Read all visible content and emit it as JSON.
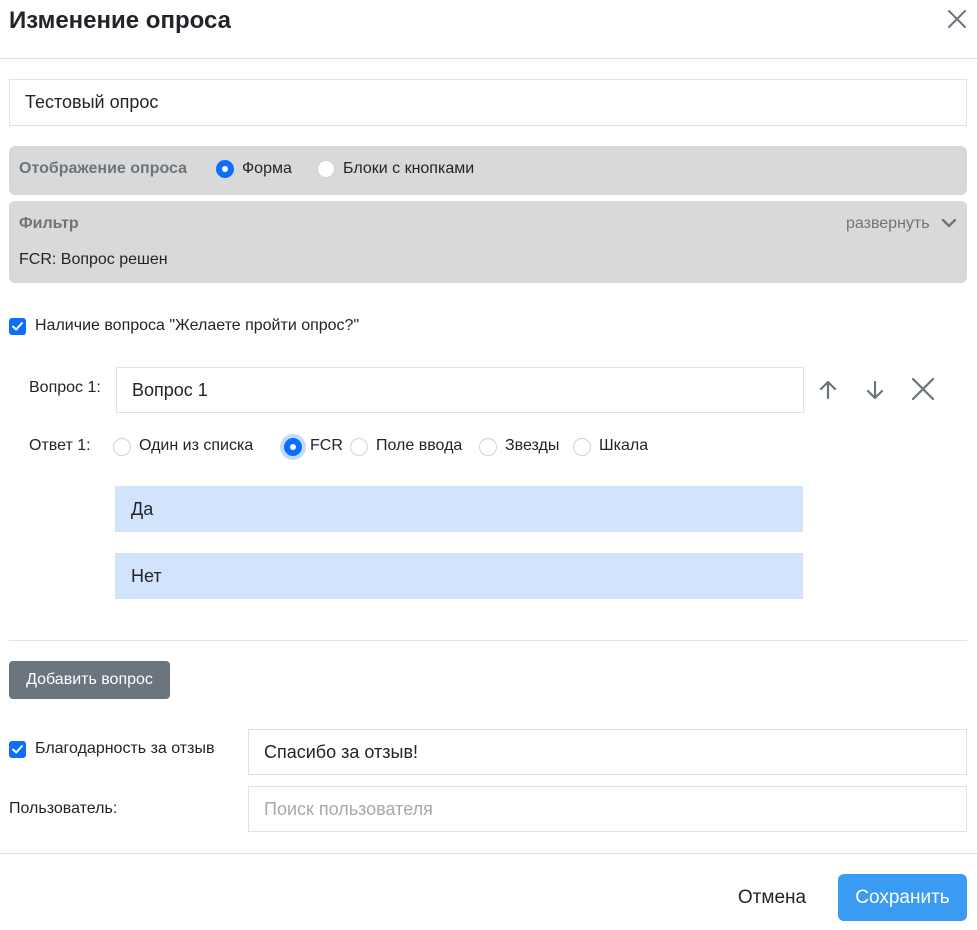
{
  "modal": {
    "title": "Изменение опроса"
  },
  "survey_name": {
    "value": "Тестовый опрос"
  },
  "display_mode": {
    "label": "Отображение опроса",
    "options": [
      "Форма",
      "Блоки с кнопками"
    ],
    "selected": "Форма"
  },
  "filter": {
    "label": "Фильтр",
    "expand_label": "развернуть",
    "value": "FCR: Вопрос решен"
  },
  "intro_question": {
    "checked": true,
    "label": "Наличие вопроса \"Желаете пройти опрос?\""
  },
  "questions": [
    {
      "label": "Вопрос 1:",
      "value": "Вопрос 1",
      "answer_label": "Ответ 1:",
      "answer_types": [
        "Один из списка",
        "FCR",
        "Поле ввода",
        "Звезды",
        "Шкала"
      ],
      "selected_type": "FCR",
      "answers": [
        "Да",
        "Нет"
      ]
    }
  ],
  "add_question": {
    "label": "Добавить вопрос"
  },
  "thanks": {
    "checked": true,
    "label": "Благодарность за отзыв",
    "value": "Спасибо за отзыв!"
  },
  "user": {
    "label": "Пользователь:",
    "placeholder": "Поиск пользователя"
  },
  "footer": {
    "cancel_label": "Отмена",
    "save_label": "Сохранить"
  },
  "colors": {
    "primary": "#0d6efd",
    "save_button": "#3a9bf3",
    "secondary_button": "#6c757d",
    "panel": "#d9d9d9",
    "answer_row": "#d2e4fc"
  }
}
